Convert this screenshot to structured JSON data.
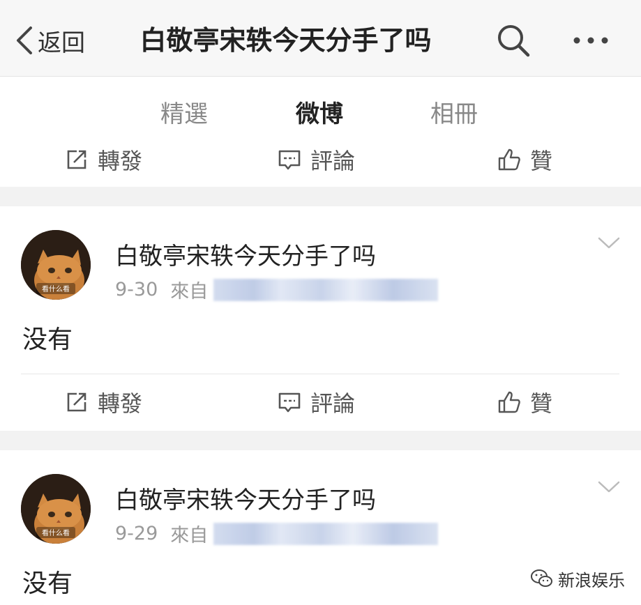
{
  "header": {
    "back_label": "返回",
    "title": "白敬亭宋轶今天分手了吗",
    "search_icon": "search-icon",
    "more_icon": "more-icon"
  },
  "tabs": [
    {
      "label": "精選",
      "active": false
    },
    {
      "label": "微博",
      "active": true
    },
    {
      "label": "相冊",
      "active": false
    }
  ],
  "accent_color": "#ff8200",
  "actions": {
    "repost": "轉發",
    "comment": "評論",
    "like": "贊"
  },
  "posts": [
    {
      "avatar_text": "看什么看",
      "username": "白敬亭宋轶今天分手了吗",
      "date": "9-30",
      "source_prefix": "來自",
      "text": "没有"
    },
    {
      "avatar_text": "看什么看",
      "username": "白敬亭宋轶今天分手了吗",
      "date": "9-29",
      "source_prefix": "來自",
      "text": "没有"
    }
  ],
  "watermark": {
    "label": "新浪娱乐"
  }
}
